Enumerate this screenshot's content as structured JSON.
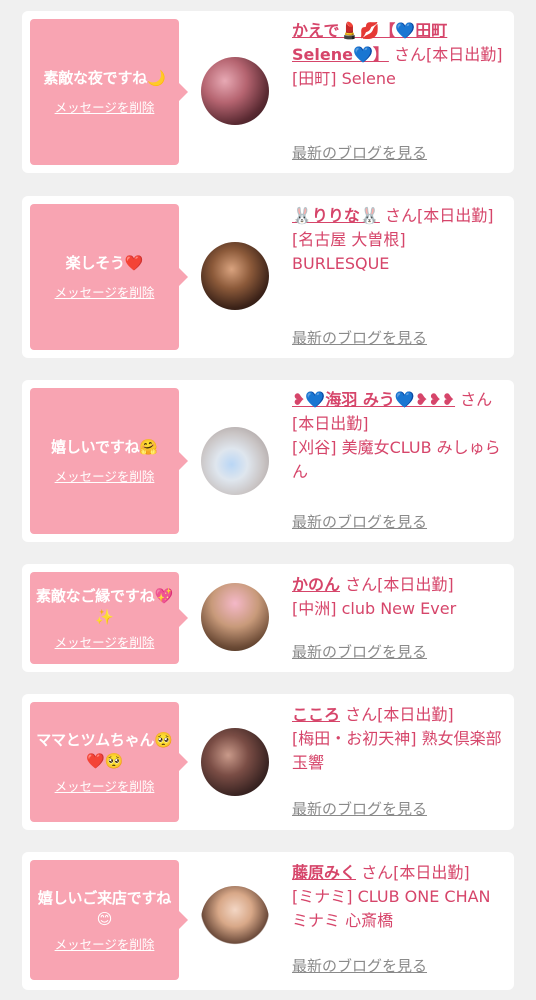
{
  "delete_label": "メッセージを削除",
  "blog_label": "最新のブログを見る",
  "entries": [
    {
      "msg": "素敵な夜ですね🌙",
      "name": "かえで💄💋【💙田町Selene💙】",
      "san": "さん[本日出勤]",
      "shop": "[田町] Selene"
    },
    {
      "msg": "楽しそう❤️",
      "name": "🐰りりな🐰",
      "san": "さん[本日出勤]",
      "shop": "[名古屋 大曽根] BURLESQUE"
    },
    {
      "msg": "嬉しいですね🤗",
      "name": "❥💙海羽 みう💙❥❥❥",
      "san": "さん[本日出勤]",
      "shop": "[刈谷] 美魔女CLUB みしゅらん"
    },
    {
      "msg": "素敵なご縁ですね💖✨",
      "name": "かのん",
      "san": "さん[本日出勤]",
      "shop": "[中洲] club New Ever"
    },
    {
      "msg": "ママとツムちゃん🥺❤️🥺",
      "name": "こころ",
      "san": "さん[本日出勤]",
      "shop": "[梅田・お初天神] 熟女倶楽部 玉響"
    },
    {
      "msg": "嬉しいご来店ですね😊",
      "name": "藤原みく",
      "san": "さん[本日出勤]",
      "shop": "[ミナミ] CLUB ONE CHAN ミナミ 心斎橋"
    }
  ],
  "colors": {
    "bubble": "#f8a4b2",
    "accent": "#d6456a",
    "link_gray": "#8a8a8a",
    "background": "#f0f0f0"
  }
}
